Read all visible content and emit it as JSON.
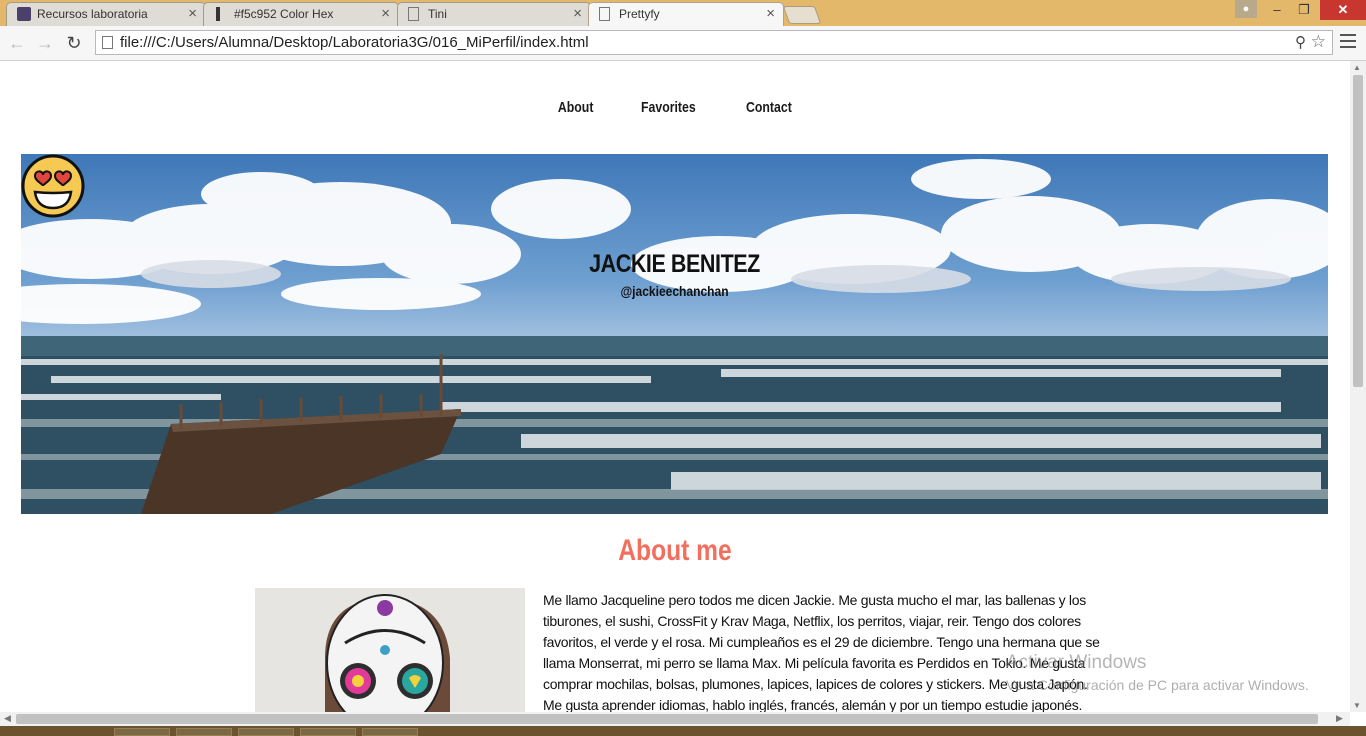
{
  "browser": {
    "tabs": [
      {
        "title": "Recursos laboratoria",
        "icon": "code-icon"
      },
      {
        "title": "#f5c952 Color Hex",
        "icon": "color-swatch-icon"
      },
      {
        "title": "Tini",
        "icon": "page-icon"
      },
      {
        "title": "Prettyfy",
        "icon": "page-icon",
        "active": true
      }
    ],
    "address": "file:///C:/Users/Alumna/Desktop/Laboratoria3G/016_MiPerfil/index.html"
  },
  "page": {
    "nav": [
      "About",
      "Favorites",
      "Contact"
    ],
    "hero": {
      "name": "JACKIE BENITEZ",
      "handle": "@jackieechanchan"
    },
    "about": {
      "title": "About me",
      "text": "Me llamo Jacqueline pero todos me dicen Jackie. Me gusta mucho el mar, las ballenas y los tiburones, el sushi, CrossFit y Krav Maga, Netflix, los perritos, viajar, reir. Tengo dos colores favoritos, el verde y el rosa. Mi cumpleaños es el 29 de diciembre. Tengo una hermana que se llama Monserrat, mi perro se llama Max. Mi película favorita es Perdidos en Tokio. Me gusta comprar mochilas, bolsas, plumones, lapices, lapices de colores y stickers. Me gusta Japón. Me gusta aprender idiomas, hablo inglés, francés, alemán y por un tiempo estudie japonés. Estudie"
    },
    "accent_color": "#f26f5e"
  },
  "os": {
    "watermark_title": "Activar Windows",
    "watermark_sub": "Ve a Configuración de PC para activar Windows."
  }
}
